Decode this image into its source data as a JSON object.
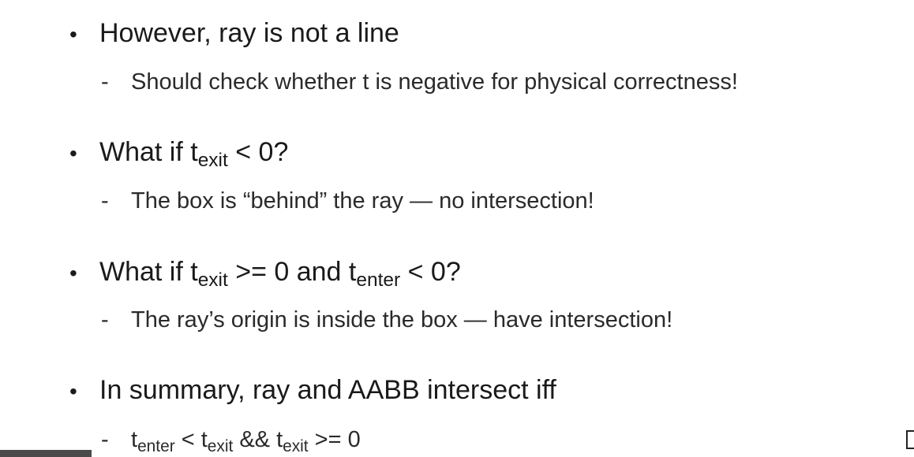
{
  "bullets": [
    {
      "text": "However, ray is not a line",
      "sub": "Should check whether t is negative for physical correctness!"
    },
    {
      "pre": "What if t",
      "sub1": "exit",
      "post": " < 0?",
      "sub": "The box is “behind” the ray — no intersection!"
    },
    {
      "pre": "What if t",
      "sub1": "exit",
      "mid": " >= 0 and t",
      "sub2": "enter",
      "post": " < 0?",
      "sub": "The ray’s origin is inside the box — have intersection!"
    },
    {
      "text": "In summary, ray and AABB intersect iff",
      "sub_parts": {
        "t1": "t",
        "s1": "enter",
        "op1": " < t",
        "s2": "exit",
        "op2": " && t",
        "s3": "exit",
        "op3": " >= 0"
      }
    }
  ],
  "bullet_symbol": "•",
  "dash_symbol": "-"
}
